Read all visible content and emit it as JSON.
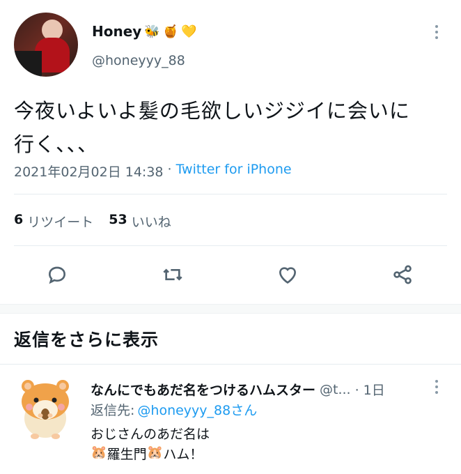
{
  "tweet": {
    "display_name": "Honey",
    "name_emojis": [
      "🐝",
      "🍯",
      "💛"
    ],
    "handle": "@honeyyy_88",
    "text_line1": "今夜いよいよ髪の毛欲しいジジイに会いに",
    "text_line2": "行く、、、",
    "datetime": "2021年02月02日 14:38",
    "separator": "·",
    "source": "Twitter for iPhone",
    "retweet_count": "6",
    "retweet_label": "リツイート",
    "like_count": "53",
    "like_label": "いいね"
  },
  "section": {
    "more_replies": "返信をさらに表示"
  },
  "reply": {
    "display_name": "なんにでもあだ名をつけるハムスター",
    "handle_truncated": "@t...",
    "time": "· 1日",
    "replying_to_label": "返信先:",
    "replying_to_handle": "@honeyyy_88さん",
    "text_line1": "おじさんのあだ名は",
    "text_line2_emoji_a": "🐹",
    "text_line2_mid": "羅生門",
    "text_line2_emoji_b": "🐹",
    "text_line2_end": "ハム！"
  },
  "colors": {
    "accent": "#1d9bf0",
    "muted": "#536471",
    "divider": "#e6ecf0",
    "section_gap": "#f7f9f9"
  }
}
